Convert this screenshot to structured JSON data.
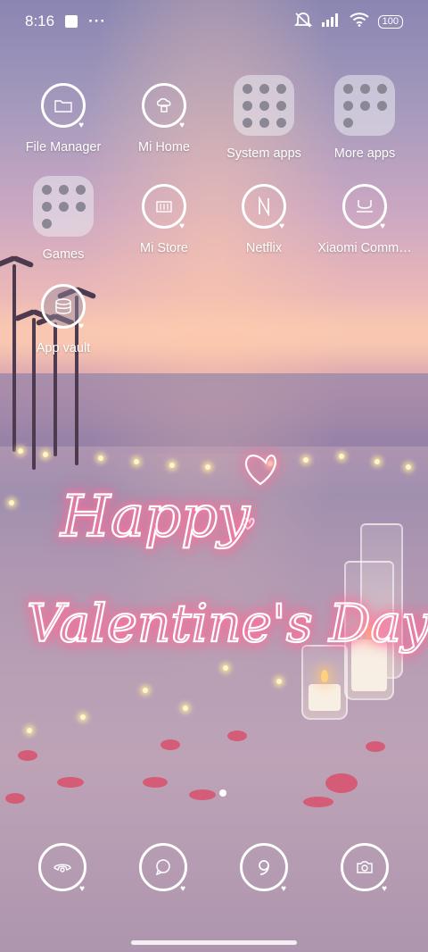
{
  "status_bar": {
    "time": "8:16",
    "left_icons": [
      "square-notification-icon",
      "more-dots-icon"
    ],
    "right_icons": [
      "mute-icon",
      "signal-icon",
      "wifi-icon",
      "battery-icon"
    ],
    "battery": "100"
  },
  "apps": [
    {
      "label": "File Manager",
      "icon": "folder-icon"
    },
    {
      "label": "Mi Home",
      "icon": "mi-home-icon"
    },
    {
      "label": "System apps",
      "icon": "folder-grid-icon"
    },
    {
      "label": "More apps",
      "icon": "folder-grid-icon"
    },
    {
      "label": "Games",
      "icon": "folder-grid-icon"
    },
    {
      "label": "Mi Store",
      "icon": "mi-store-icon"
    },
    {
      "label": "Netflix",
      "icon": "netflix-icon"
    },
    {
      "label": "Xiaomi Comm…",
      "icon": "xiaomi-community-icon"
    },
    {
      "label": "App vault",
      "icon": "app-vault-icon"
    }
  ],
  "wallpaper": {
    "line1": "Happy",
    "line2": "Valentine's Day"
  },
  "dock": [
    "phone-icon",
    "messages-icon",
    "browser-icon",
    "camera-icon"
  ],
  "colors": {
    "neon_glow": "#ff5c8e",
    "petal": "#d9506c"
  }
}
